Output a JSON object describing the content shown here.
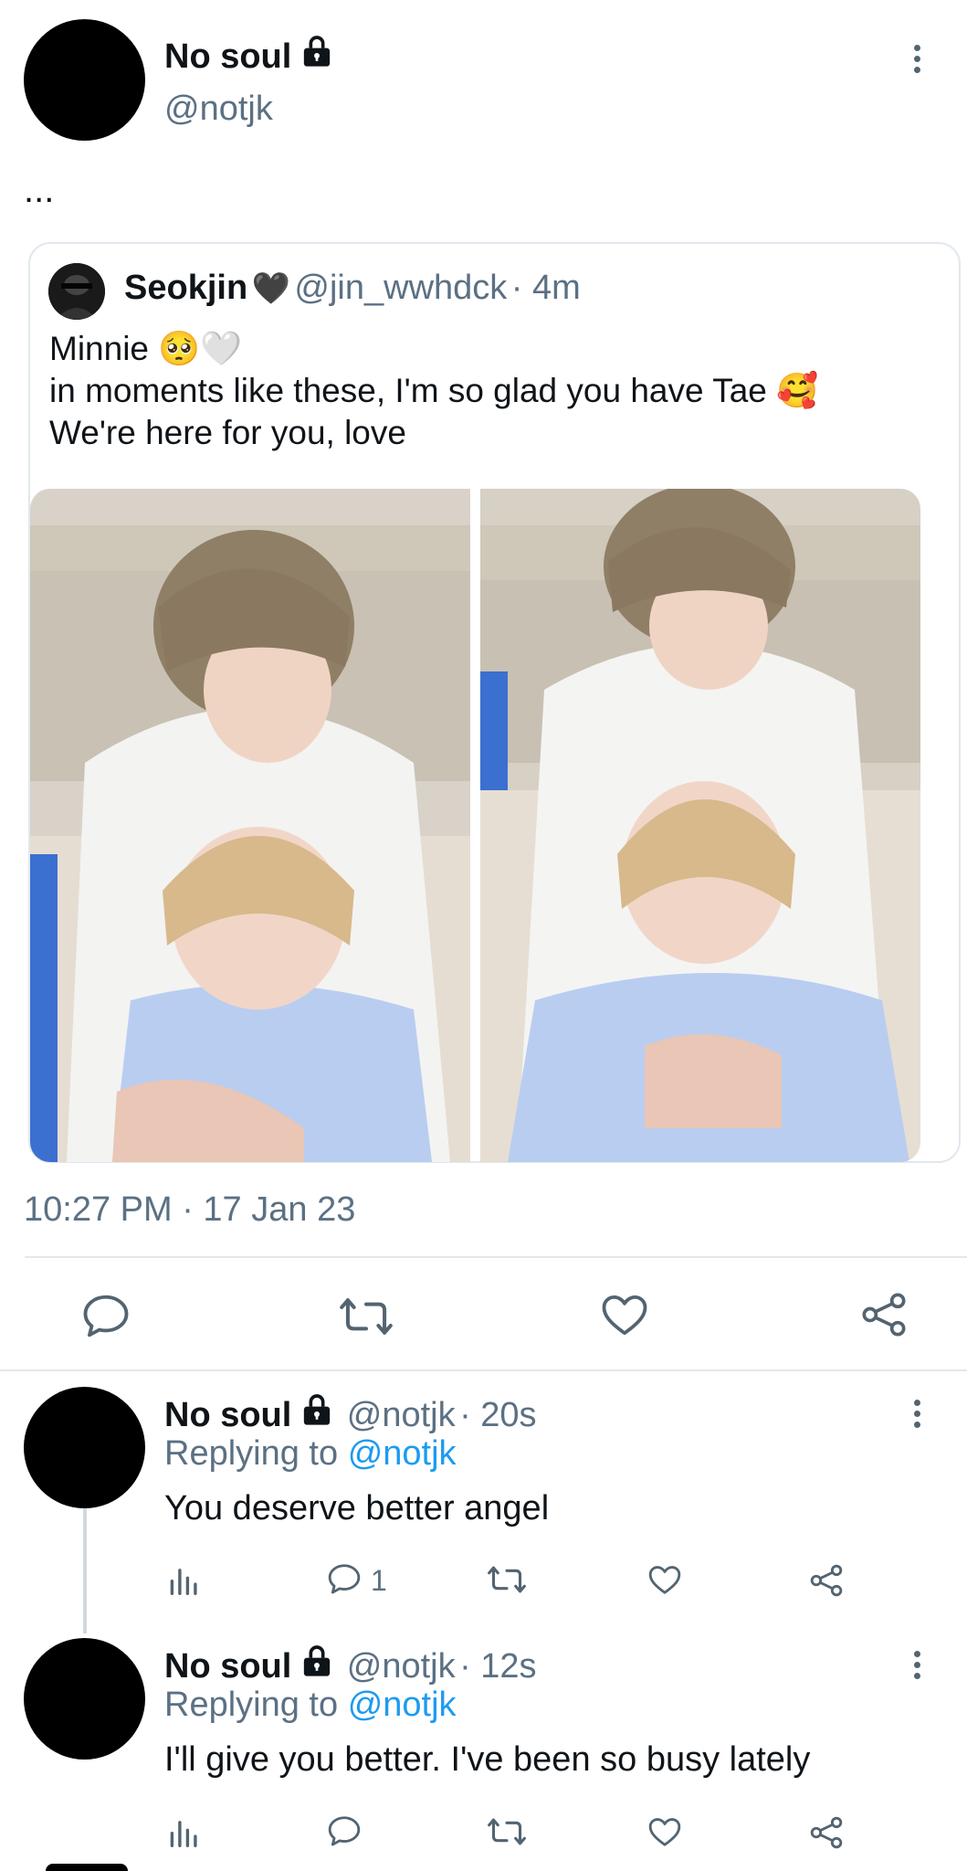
{
  "main_tweet": {
    "author_name": "No soul",
    "author_handle": "@notjk",
    "text": "...",
    "timestamp": "10:27 PM · 17 Jan 23"
  },
  "quoted_tweet": {
    "author_name": "Seokjin",
    "heart_emoji": "🖤",
    "author_handle": "@jin_wwhdck",
    "time": "· 4m",
    "line1": "Minnie 🥺🤍",
    "line2": "in moments like these, I'm so glad you have Tae 🥰",
    "line3": "We're here for you, love"
  },
  "actions": [
    "reply-icon",
    "retweet-icon",
    "like-icon",
    "share-icon"
  ],
  "replies": [
    {
      "author_name": "No soul",
      "author_handle": "@notjk",
      "time": "· 20s",
      "replying_prefix": "Replying to",
      "replying_to": "@notjk",
      "text": "You deserve better angel",
      "reply_count": "1"
    },
    {
      "author_name": "No soul",
      "author_handle": "@notjk",
      "time": "· 12s",
      "replying_prefix": "Replying to",
      "replying_to": "@notjk",
      "text": "I'll give you better. I've been so busy lately",
      "reply_count": ""
    }
  ],
  "colors": {
    "accent": "#1d9bf0",
    "muted": "#5b7083",
    "border": "#e1e8ed"
  }
}
